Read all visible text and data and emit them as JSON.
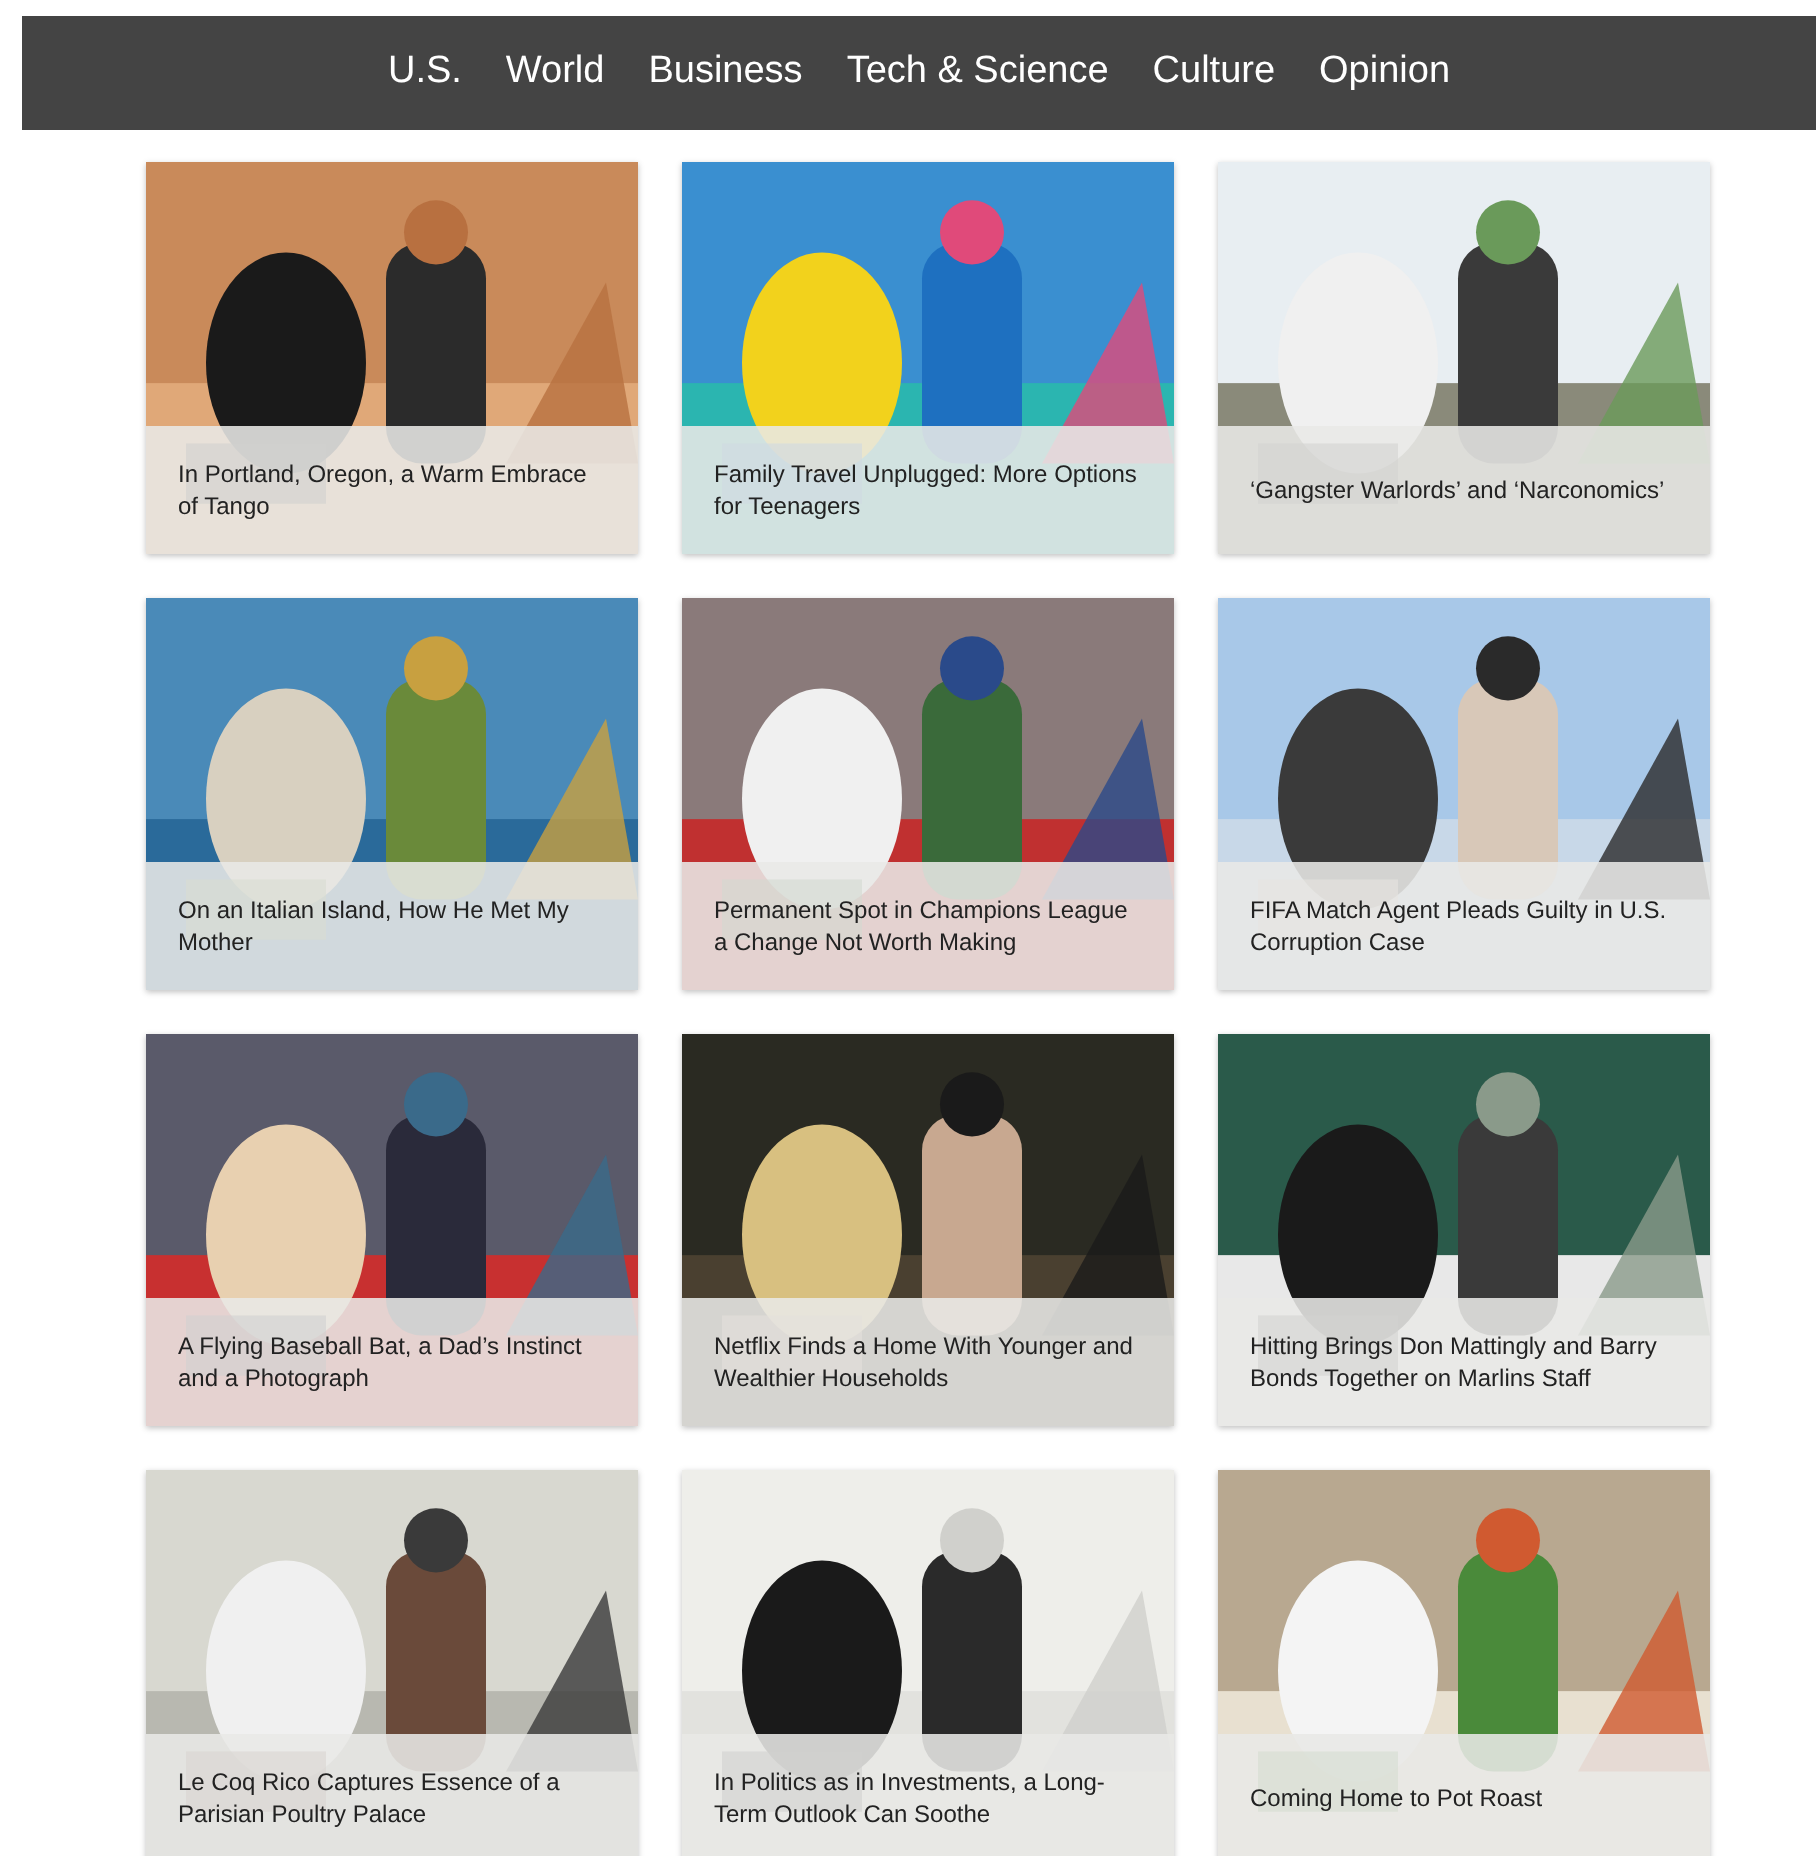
{
  "nav": {
    "items": [
      {
        "label": "U.S."
      },
      {
        "label": "World"
      },
      {
        "label": "Business"
      },
      {
        "label": "Tech & Science"
      },
      {
        "label": "Culture"
      },
      {
        "label": "Opinion"
      }
    ]
  },
  "articles": [
    {
      "caption": "In Portland, Oregon, a Warm Embrace of Tango"
    },
    {
      "caption": "Family Travel Unplugged: More Options for Teenagers"
    },
    {
      "caption": "‘Gangster Warlords’ and ‘Narconomics’"
    },
    {
      "caption": "On an Italian Island, How He Met My Mother"
    },
    {
      "caption": "Permanent Spot in Champions League a Change Not Worth Making"
    },
    {
      "caption": "FIFA Match Agent Pleads Guilty in U.S. Corruption Case"
    },
    {
      "caption": "A Flying Baseball Bat, a Dad’s Instinct and a Photograph"
    },
    {
      "caption": "Netflix Finds a Home With Younger and Wealthier Households"
    },
    {
      "caption": "Hitting Brings Don Mattingly and Barry Bonds Together on Marlins Staff"
    },
    {
      "caption": "Le Coq Rico Captures Essence of a Parisian Poultry Palace"
    },
    {
      "caption": "In Politics as in Investments, a Long-Term Outlook Can Soothe"
    },
    {
      "caption": "Coming Home to Pot Roast"
    }
  ]
}
